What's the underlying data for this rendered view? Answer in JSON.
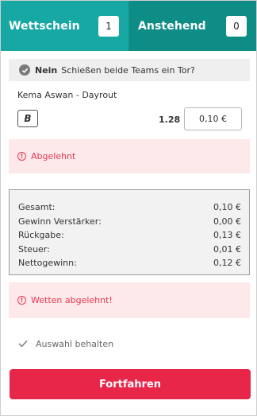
{
  "tabs": [
    {
      "label": "Wettschein",
      "count": "1"
    },
    {
      "label": "Anstehend",
      "count": "0"
    }
  ],
  "selection": {
    "pick": "Nein",
    "market": "Schießen beide Teams ein Tor?",
    "match": "Kema Aswan - Dayrout",
    "boost_label": "B",
    "odds": "1.28",
    "stake_value": "0,10 €"
  },
  "alerts": {
    "rejected": "Abgelehnt",
    "bets_rejected": "Wetten abgelehnt!"
  },
  "summary": {
    "rows": [
      {
        "label": "Gesamt:",
        "value": "0,10 €"
      },
      {
        "label": "Gewinn Verstärker:",
        "value": "0,00 €"
      },
      {
        "label": "Rückgabe:",
        "value": "0,13 €"
      },
      {
        "label": "Steuer:",
        "value": "0,01 €"
      },
      {
        "label": "Nettogewinn:",
        "value": "0,12 €"
      }
    ]
  },
  "keep_selection": {
    "label": "Auswahl behalten",
    "checked": true
  },
  "continue_label": "Fortfahren",
  "colors": {
    "tab_active": "#17a8a4",
    "tab_inactive": "#0e8d87",
    "alert_text": "#e53950",
    "alert_bg": "#fde8ea",
    "primary_button": "#e8264a"
  }
}
